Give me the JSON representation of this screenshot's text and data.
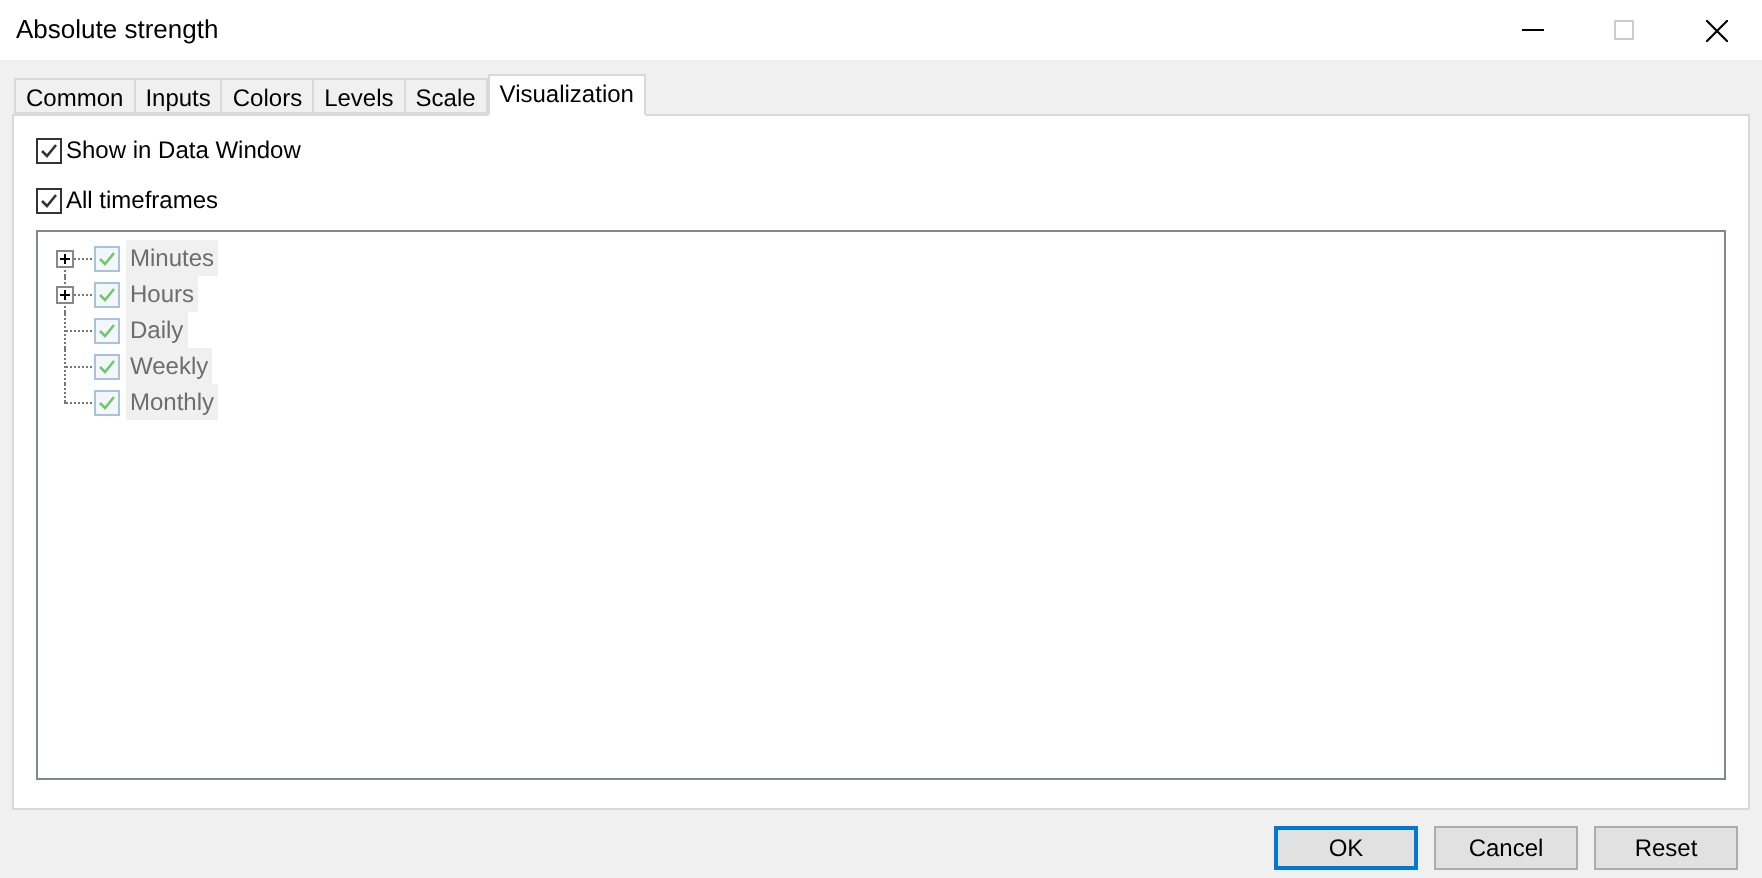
{
  "window": {
    "title": "Absolute strength"
  },
  "tabs": [
    {
      "label": "Common",
      "selected": false
    },
    {
      "label": "Inputs",
      "selected": false
    },
    {
      "label": "Colors",
      "selected": false
    },
    {
      "label": "Levels",
      "selected": false
    },
    {
      "label": "Scale",
      "selected": false
    },
    {
      "label": "Visualization",
      "selected": true
    }
  ],
  "options": [
    {
      "label": "Show in Data Window",
      "checked": true
    },
    {
      "label": "All timeframes",
      "checked": true
    }
  ],
  "tree": {
    "disabled": true,
    "items": [
      {
        "label": "Minutes",
        "kind": "group",
        "expanded": false,
        "checked": true
      },
      {
        "label": "Hours",
        "kind": "group",
        "expanded": false,
        "checked": true
      },
      {
        "label": "Daily",
        "kind": "leaf",
        "checked": true
      },
      {
        "label": "Weekly",
        "kind": "leaf",
        "checked": true
      },
      {
        "label": "Monthly",
        "kind": "leaf",
        "checked": true
      }
    ]
  },
  "buttons": [
    {
      "label": "OK",
      "selected": true
    },
    {
      "label": "Cancel",
      "selected": false
    },
    {
      "label": "Reset",
      "selected": false
    }
  ]
}
